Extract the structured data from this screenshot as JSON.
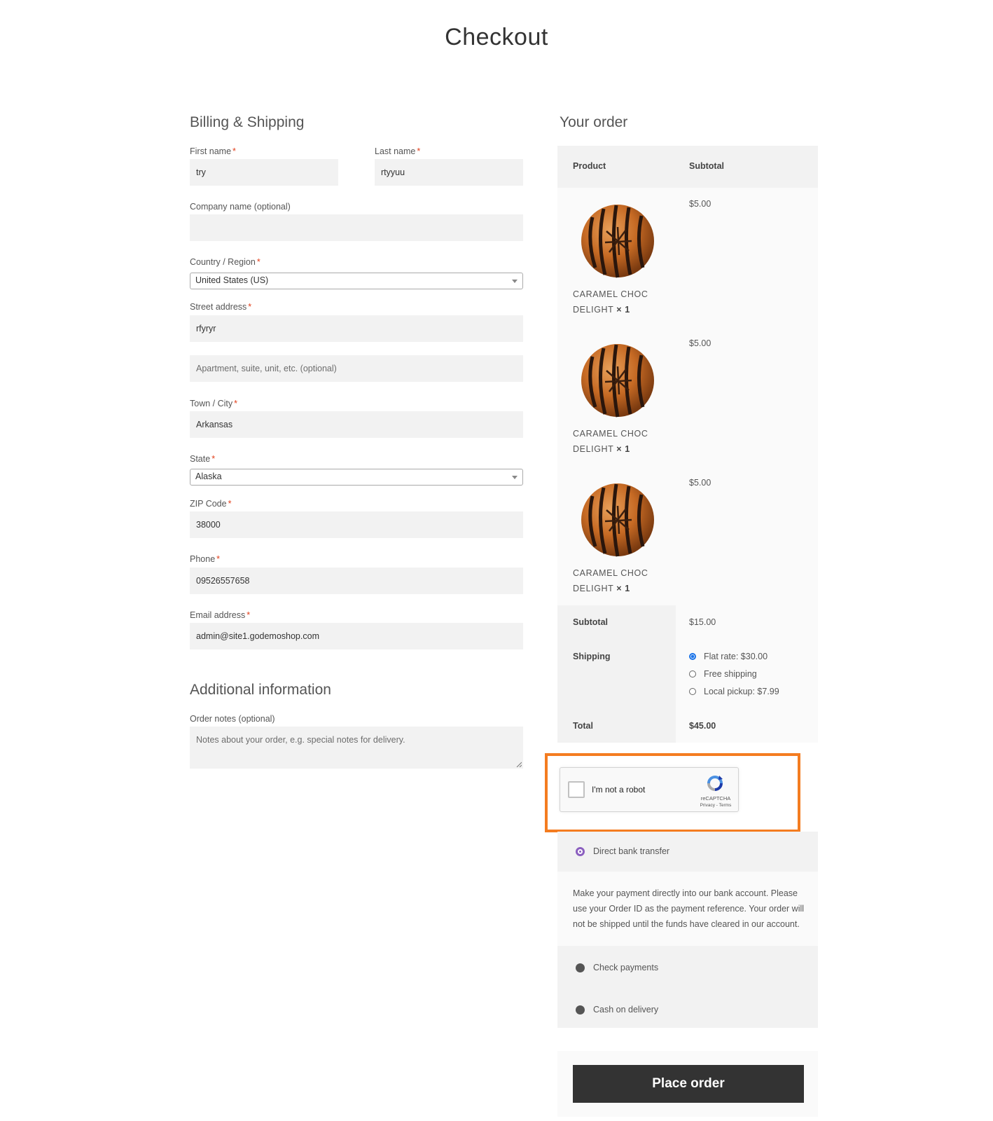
{
  "page": {
    "title": "Checkout"
  },
  "billing": {
    "title": "Billing & Shipping",
    "required_marker": "*",
    "first_name": {
      "label": "First name",
      "value": "try"
    },
    "last_name": {
      "label": "Last name",
      "value": "rtyyuu"
    },
    "company": {
      "label": "Company name (optional)",
      "value": ""
    },
    "country": {
      "label": "Country / Region",
      "value": "United States (US)"
    },
    "street": {
      "label": "Street address",
      "value": "rfyryr"
    },
    "apartment": {
      "placeholder": "Apartment, suite, unit, etc. (optional)",
      "value": ""
    },
    "city": {
      "label": "Town / City",
      "value": "Arkansas"
    },
    "state": {
      "label": "State",
      "value": "Alaska"
    },
    "zip": {
      "label": "ZIP Code",
      "value": "38000"
    },
    "phone": {
      "label": "Phone",
      "value": "09526557658"
    },
    "email": {
      "label": "Email address",
      "value": "admin@site1.godemoshop.com"
    }
  },
  "additional": {
    "title": "Additional information",
    "notes": {
      "label": "Order notes (optional)",
      "placeholder": "Notes about your order, e.g. special notes for delivery."
    }
  },
  "order": {
    "title": "Your order",
    "headers": {
      "product": "Product",
      "subtotal": "Subtotal"
    },
    "items": [
      {
        "name_line1": "CARAMEL CHOC",
        "name_line2": "DELIGHT",
        "qty": "× 1",
        "price": "$5.00"
      },
      {
        "name_line1": "CARAMEL CHOC",
        "name_line2": "DELIGHT",
        "qty": "× 1",
        "price": "$5.00"
      },
      {
        "name_line1": "CARAMEL CHOC",
        "name_line2": "DELIGHT",
        "qty": "× 1",
        "price": "$5.00"
      }
    ],
    "subtotal_label": "Subtotal",
    "subtotal_value": "$15.00",
    "shipping_label": "Shipping",
    "shipping_options": [
      {
        "label": "Flat rate: $30.00",
        "selected": true
      },
      {
        "label": "Free shipping",
        "selected": false
      },
      {
        "label": "Local pickup: $7.99",
        "selected": false
      }
    ],
    "total_label": "Total",
    "total_value": "$45.00"
  },
  "recaptcha": {
    "label": "I'm not a robot",
    "brand": "reCAPTCHA",
    "links": "Privacy - Terms",
    "highlight_color": "#f47c20"
  },
  "payment": {
    "methods": [
      {
        "label": "Direct bank transfer",
        "selected": true
      },
      {
        "label": "Check payments",
        "selected": false
      },
      {
        "label": "Cash on delivery",
        "selected": false
      }
    ],
    "bank_description": "Make your payment directly into our bank account. Please use your Order ID as the payment reference. Your order will not be shipped until the funds have cleared in our account.",
    "place_order": "Place order"
  }
}
